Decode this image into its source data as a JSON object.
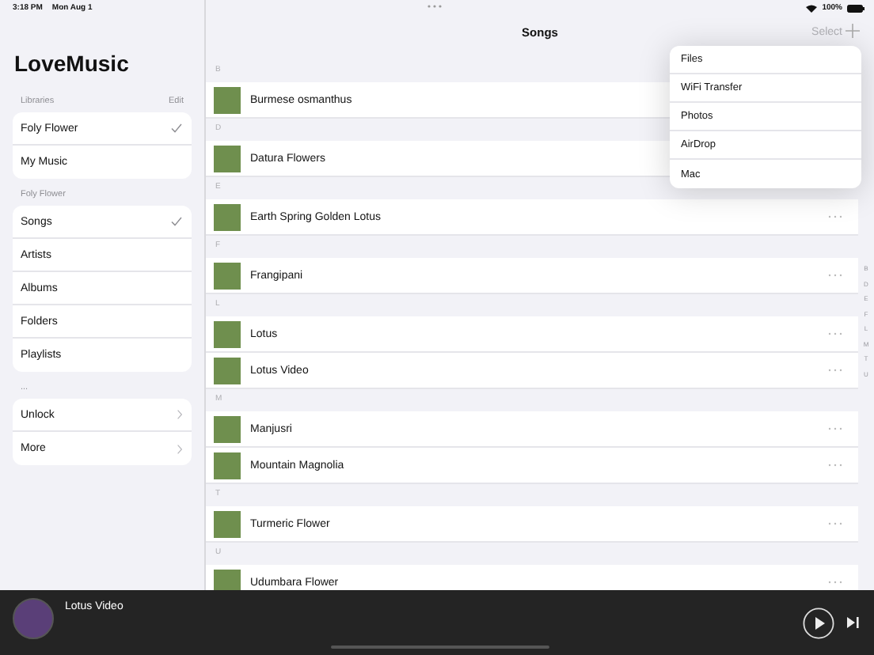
{
  "status_bar": {
    "time": "3:18 PM",
    "date": "Mon Aug 1",
    "battery": "100%"
  },
  "sidebar": {
    "title": "LoveMusic",
    "sections": [
      {
        "header": "Libraries",
        "action": "Edit",
        "items": [
          {
            "label": "Foly Flower",
            "kind": "choice",
            "selected": true
          },
          {
            "label": "My Music",
            "kind": "choice",
            "selected": false
          }
        ]
      },
      {
        "header": "Foly Flower",
        "items": [
          {
            "label": "Songs",
            "kind": "choice",
            "selected": true
          },
          {
            "label": "Artists",
            "kind": "choice",
            "selected": false
          },
          {
            "label": "Albums",
            "kind": "choice",
            "selected": false
          },
          {
            "label": "Folders",
            "kind": "choice",
            "selected": false
          },
          {
            "label": "Playlists",
            "kind": "choice",
            "selected": false
          }
        ]
      },
      {
        "header": "...",
        "items": [
          {
            "label": "Unlock",
            "kind": "link"
          },
          {
            "label": "More",
            "kind": "link"
          }
        ]
      }
    ]
  },
  "main": {
    "title": "Songs",
    "select": "Select",
    "sections": [
      {
        "letter": "B",
        "songs": [
          "Burmese osmanthus"
        ]
      },
      {
        "letter": "D",
        "songs": [
          "Datura Flowers"
        ]
      },
      {
        "letter": "E",
        "songs": [
          "Earth Spring Golden Lotus"
        ]
      },
      {
        "letter": "F",
        "songs": [
          "Frangipani"
        ]
      },
      {
        "letter": "L",
        "songs": [
          "Lotus",
          "Lotus Video"
        ]
      },
      {
        "letter": "M",
        "songs": [
          "Manjusri",
          "Mountain Magnolia"
        ]
      },
      {
        "letter": "T",
        "songs": [
          "Turmeric Flower"
        ]
      },
      {
        "letter": "U",
        "songs": [
          "Udumbara Flower"
        ]
      }
    ],
    "index": [
      "B",
      "D",
      "E",
      "F",
      "L",
      "M",
      "T",
      "U"
    ],
    "add_menu": [
      "Files",
      "WiFi Transfer",
      "Photos",
      "AirDrop",
      "Mac"
    ]
  },
  "player": {
    "title": "Lotus Video"
  }
}
